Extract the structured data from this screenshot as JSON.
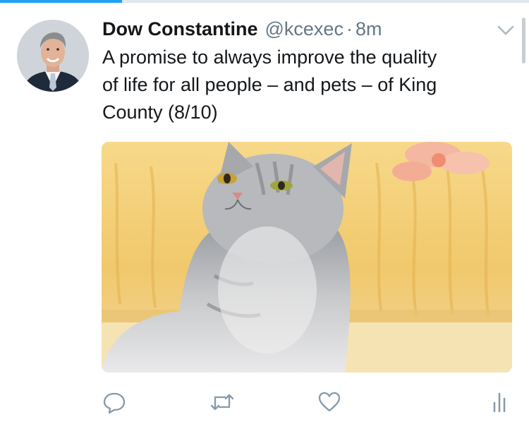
{
  "top_progress": {
    "fraction": 0.23,
    "color": "#1da1f2"
  },
  "tweet": {
    "author_name": "Dow Constantine",
    "author_handle": "@kcexec",
    "separator": "·",
    "time": "8m",
    "text": "A promise to always improve the quality\nof life for all people – and pets – of King\nCounty (8/10)"
  },
  "icons": {
    "caret": "chevron-down-icon",
    "reply": "reply-icon",
    "retweet": "retweet-icon",
    "like": "heart-icon",
    "analytics": "analytics-icon"
  },
  "colors": {
    "text": "#14171a",
    "secondary": "#657786",
    "icon": "#8899a6"
  }
}
